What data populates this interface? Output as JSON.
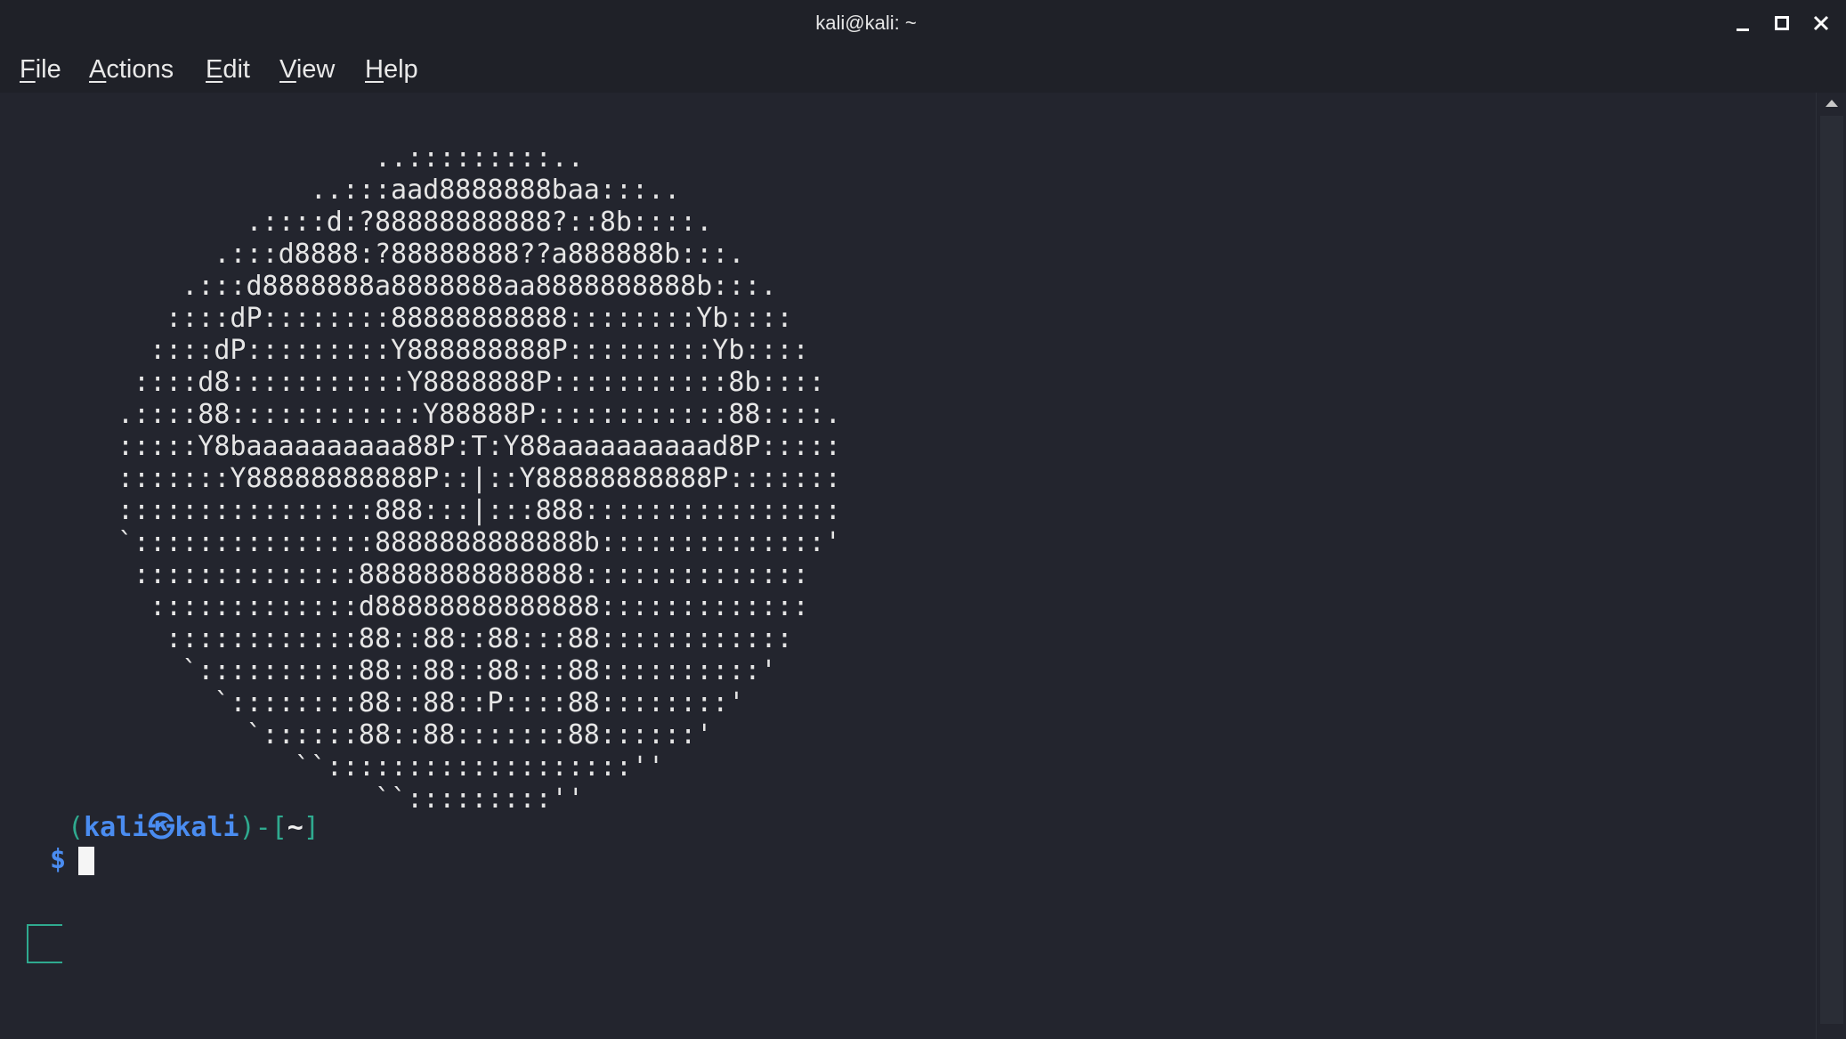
{
  "window": {
    "title": "kali@kali: ~"
  },
  "menu": {
    "file": {
      "acc": "F",
      "rest": "ile"
    },
    "actions": {
      "acc": "A",
      "rest": "ctions"
    },
    "edit": {
      "acc": "E",
      "rest": "dit"
    },
    "view": {
      "acc": "V",
      "rest": "iew"
    },
    "help": {
      "acc": "H",
      "rest": "elp"
    }
  },
  "terminal": {
    "ascii_art": "                ..:::::::::..\n            ..:::aad8888888baa:::..\n        .::::d:?88888888888?::8b::::.\n      .:::d8888:?88888888??a888888b:::.\n    .:::d8888888a8888888aa8888888888b:::.\n   ::::dP::::::::88888888888::::::::Yb::::\n  ::::dP:::::::::Y888888888P:::::::::Yb::::\n ::::d8:::::::::::Y8888888P:::::::::::8b::::\n.::::88::::::::::::Y88888P::::::::::::88::::.\n:::::Y8baaaaaaaaaa88P:T:Y88aaaaaaaaaad8P:::::\n:::::::Y88888888888P::|::Y88888888888P:::::::\n::::::::::::::::888:::|:::888::::::::::::::::\n`:::::::::::::::8888888888888b::::::::::::::'\n ::::::::::::::88888888888888::::::::::::::\n  :::::::::::::d88888888888888:::::::::::::\n   ::::::::::::88::88::88:::88::::::::::::\n    `::::::::::88::88::88:::88::::::::::'\n      `::::::::88::88::P::::88::::::::'\n        `::::::88::88:::::::88::::::'\n           ``:::::::::::::::::::''\n                ``:::::::::''",
    "prompt": {
      "open_paren": "(",
      "user": "kali",
      "at_symbol": "㉿",
      "host": "kali",
      "close_paren": ")",
      "dash": "-",
      "open_bracket": "[",
      "dir": "~",
      "close_bracket": "]",
      "symbol": "$"
    }
  },
  "colors": {
    "background": "#23252e",
    "prompt_green": "#2faa8f",
    "prompt_blue": "#4a8cf0"
  }
}
